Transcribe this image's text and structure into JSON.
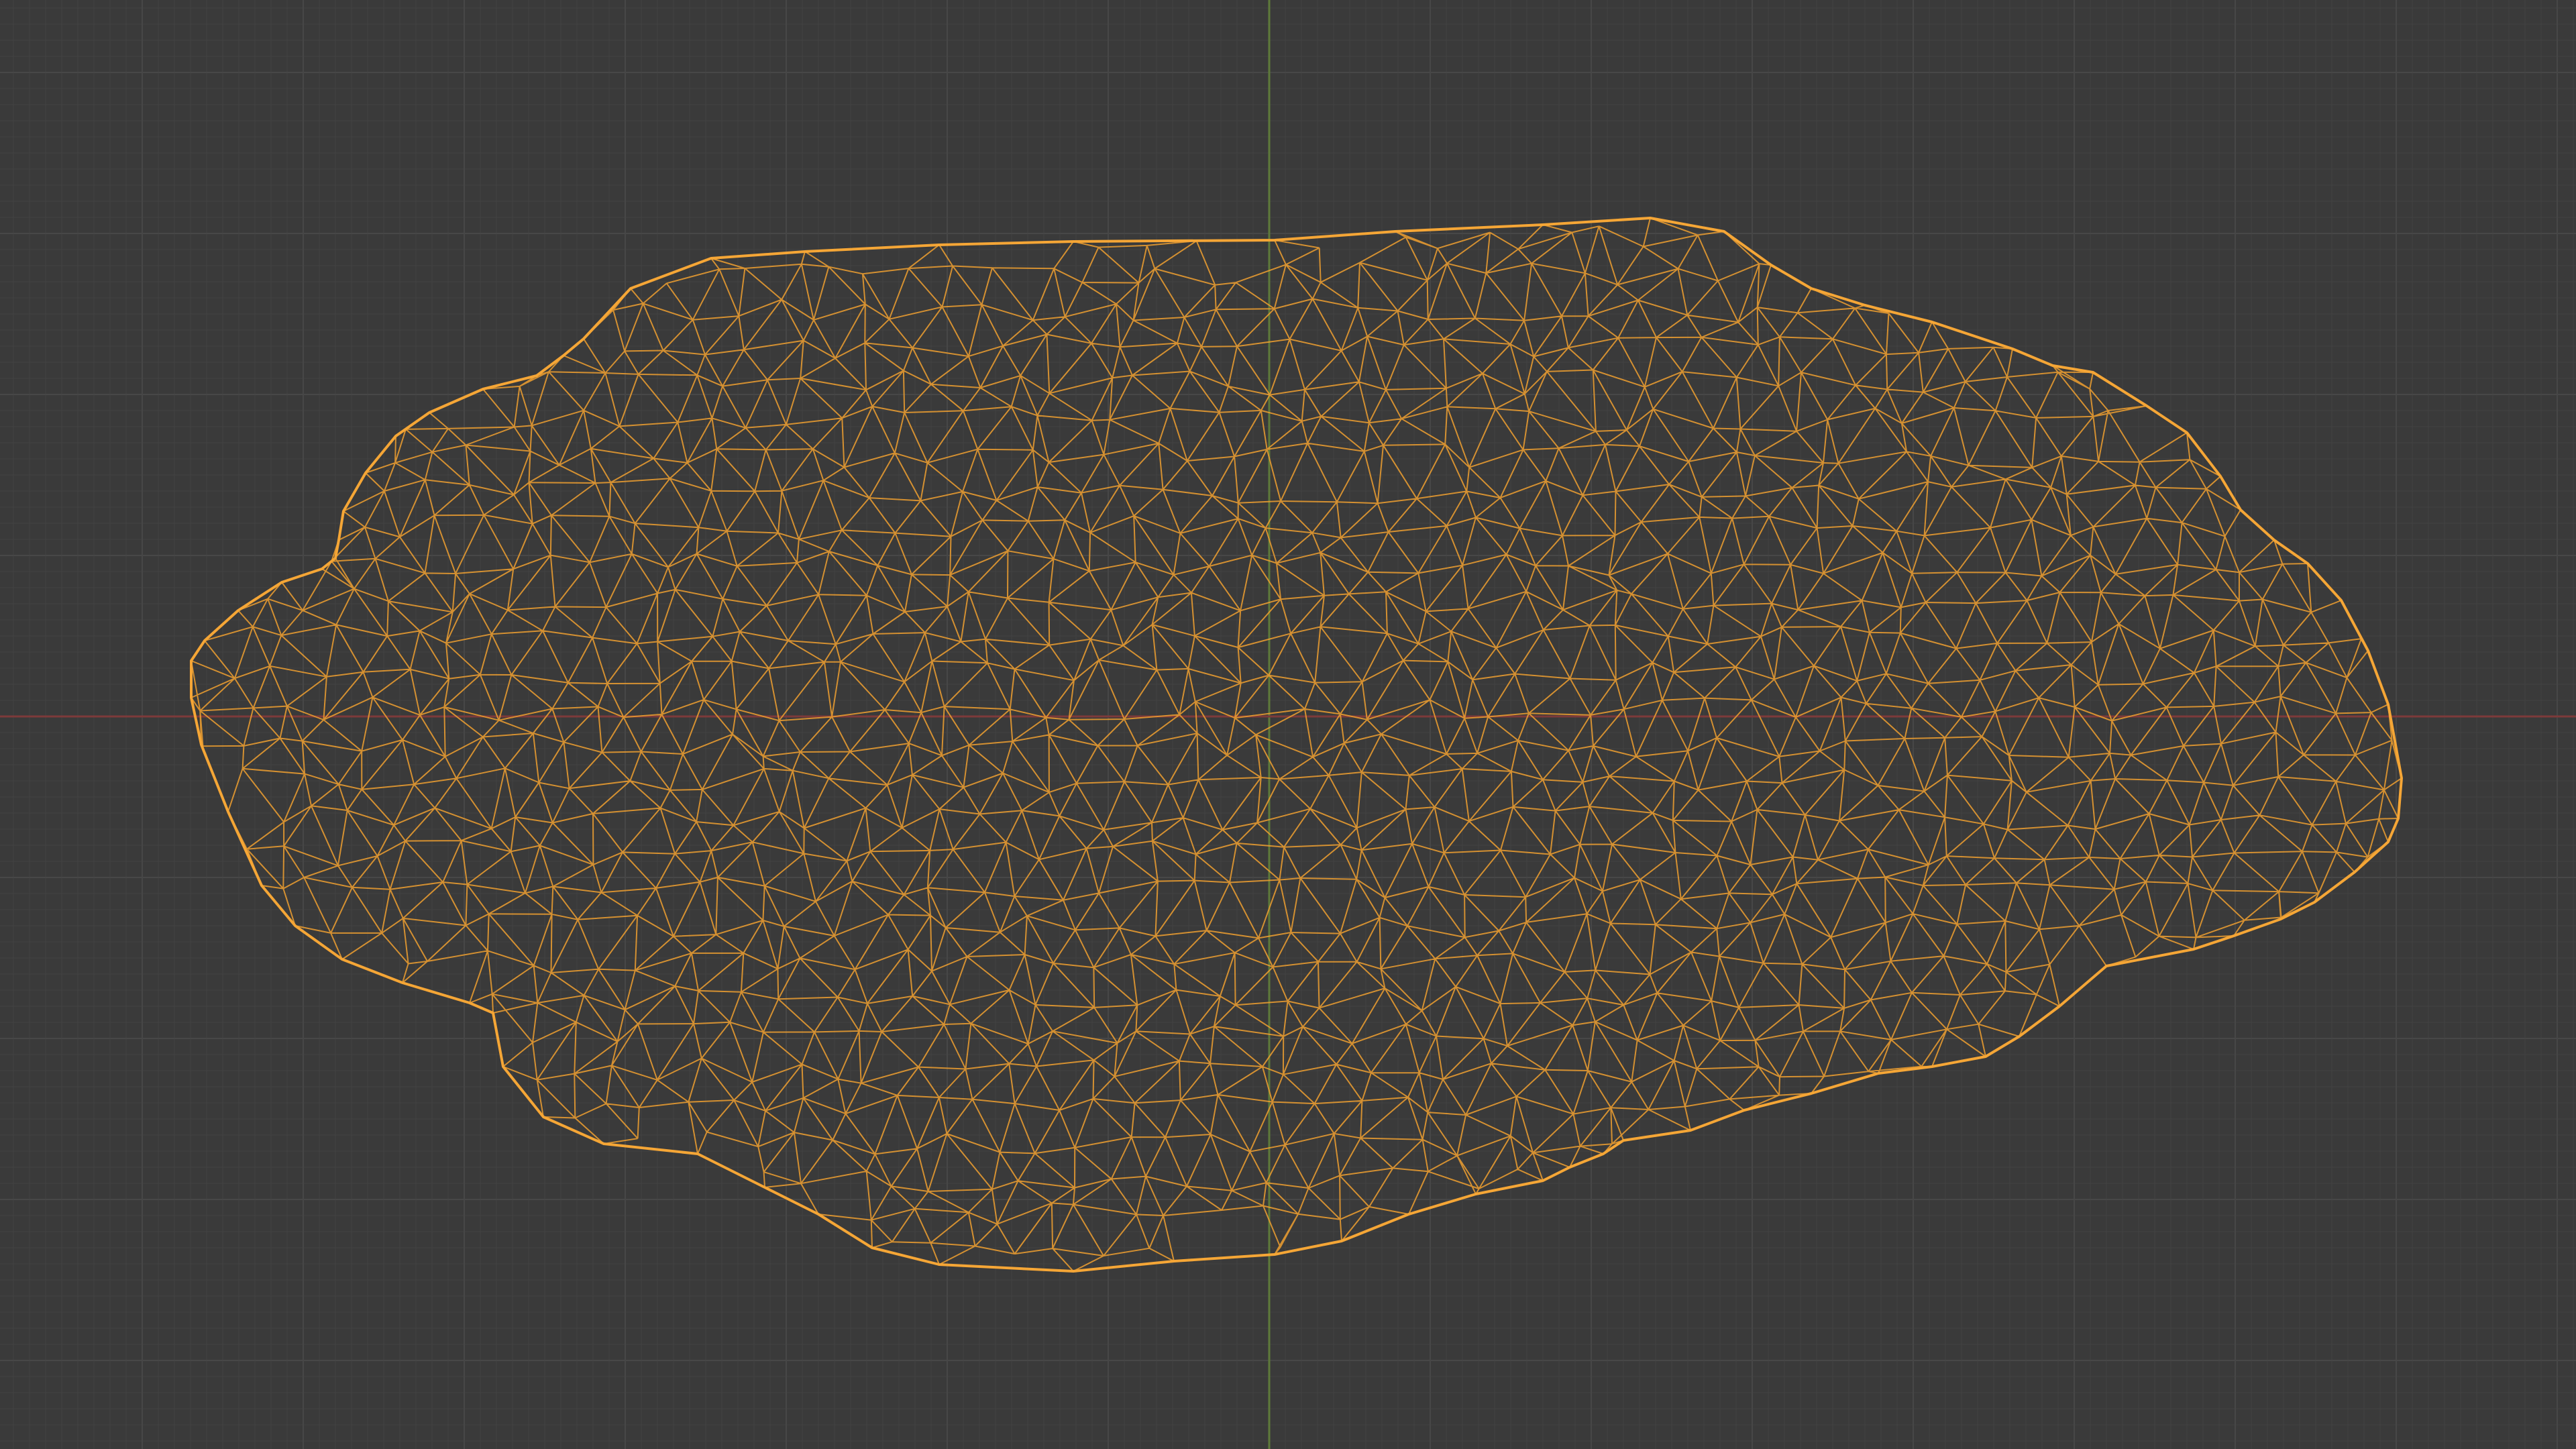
{
  "viewport": {
    "background": "#3a3a3a",
    "grid_minor_color": "#404040",
    "grid_major_color": "#474747",
    "axis_x_color": "#7d3a3a",
    "axis_y_color": "#5e7a3a",
    "wire_color": "#f0a030",
    "outline_color": "#f5a636",
    "view": "orthographic-top",
    "display_mode": "wireframe",
    "selection": "active-object"
  }
}
